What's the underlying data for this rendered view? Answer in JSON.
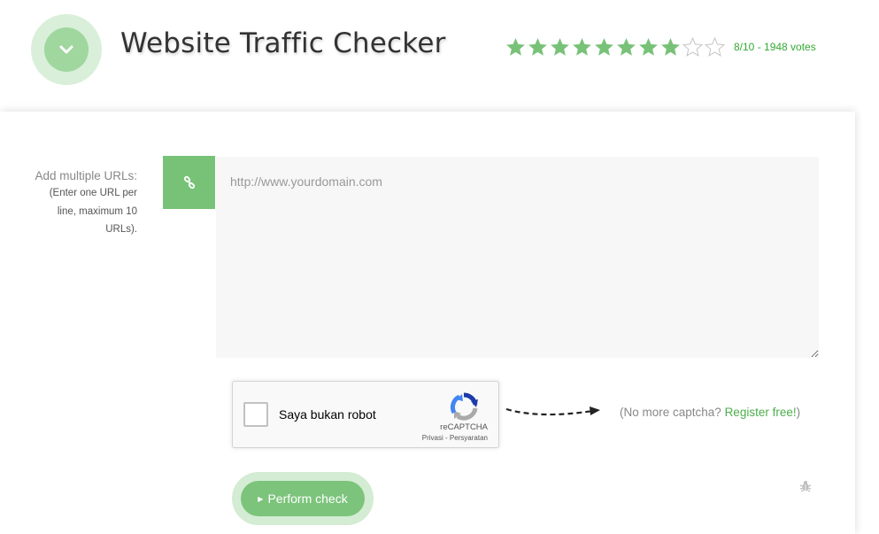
{
  "header": {
    "title": "Website Traffic Checker",
    "rating": {
      "score": 8,
      "max": 10,
      "text": "8/10 - 1948 votes",
      "color": "#78c278"
    }
  },
  "form": {
    "url_label": "Add multiple URLs:",
    "url_hint": "(Enter one URL per line, maximum 10 URLs).",
    "url_placeholder": "http://www.yourdomain.com",
    "link_button_icon": "link-icon"
  },
  "captcha": {
    "checkbox_label": "Saya bukan robot",
    "brand": "reCAPTCHA",
    "privacy_link": "Privasi",
    "terms_link": "Persyaratan",
    "separator": " - ",
    "promo_prefix": "(No more captcha? ",
    "promo_link": "Register free!",
    "promo_suffix": ")"
  },
  "actions": {
    "submit_label": "Perform check",
    "report_icon": "bug-icon"
  },
  "colors": {
    "accent": "#78c278",
    "accent_light": "#d3ecd3",
    "link": "#4cae4c"
  }
}
